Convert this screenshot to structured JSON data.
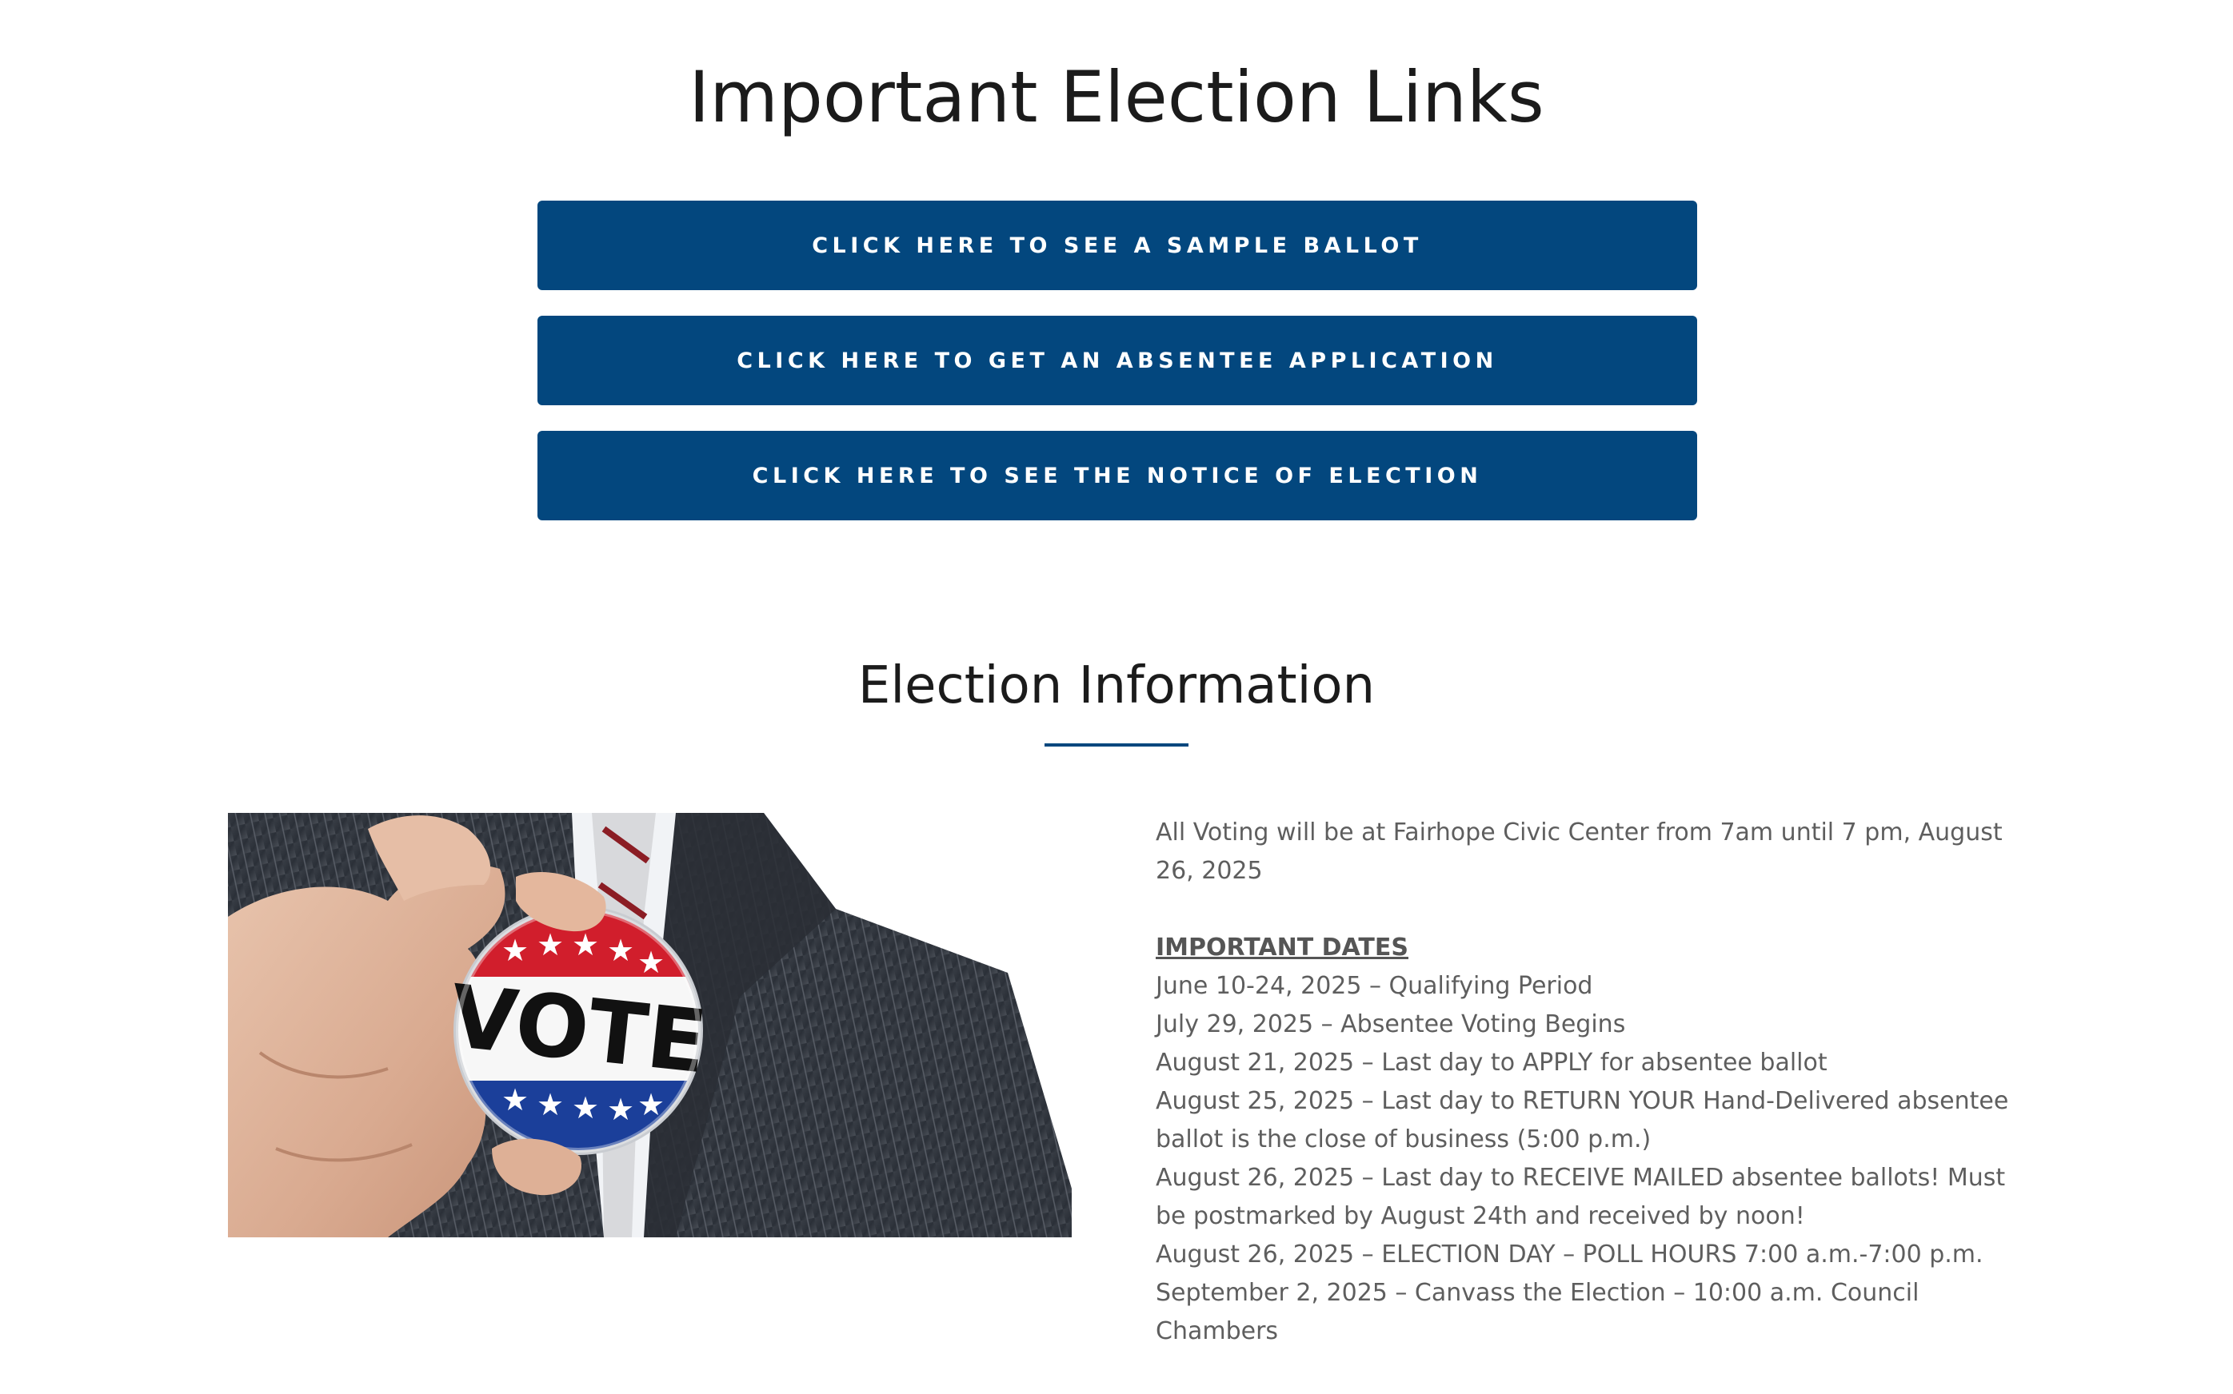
{
  "links_section": {
    "title": "Important Election Links",
    "buttons": [
      {
        "label": "CLICK HERE TO SEE A SAMPLE BALLOT"
      },
      {
        "label": "CLICK HERE TO GET AN ABSENTEE APPLICATION"
      },
      {
        "label": "CLICK HERE TO SEE THE NOTICE OF ELECTION"
      }
    ]
  },
  "info_section": {
    "title": "Election Information",
    "photo": {
      "badge_text": "VOTE",
      "icon": "vote-badge-photo"
    },
    "voting_location": "All Voting will be at Fairhope Civic Center from 7am until 7 pm, August 26, 2025",
    "dates_heading": "IMPORTANT DATES",
    "dates": [
      "June 10-24, 2025 – Qualifying Period",
      "July 29, 2025 – Absentee Voting Begins",
      "August 21, 2025 – Last day to APPLY for absentee ballot",
      "August 25, 2025 – Last day to RETURN YOUR Hand-Delivered absentee ballot is the close of business (5:00 p.m.)",
      "August 26, 2025 – Last day to RECEIVE MAILED absentee ballots! Must be postmarked by August 24th and received by noon!",
      "August 26, 2025 – ELECTION DAY – POLL HOURS 7:00 a.m.-7:00 p.m.",
      "September 2, 2025 – Canvass the Election – 10:00 a.m. Council Chambers"
    ]
  },
  "colors": {
    "button_bg": "#03477e",
    "button_text": "#ffffff",
    "heading_text": "#1b1b1b",
    "body_text": "#5e5e5e",
    "accent_underline": "#03477e"
  }
}
